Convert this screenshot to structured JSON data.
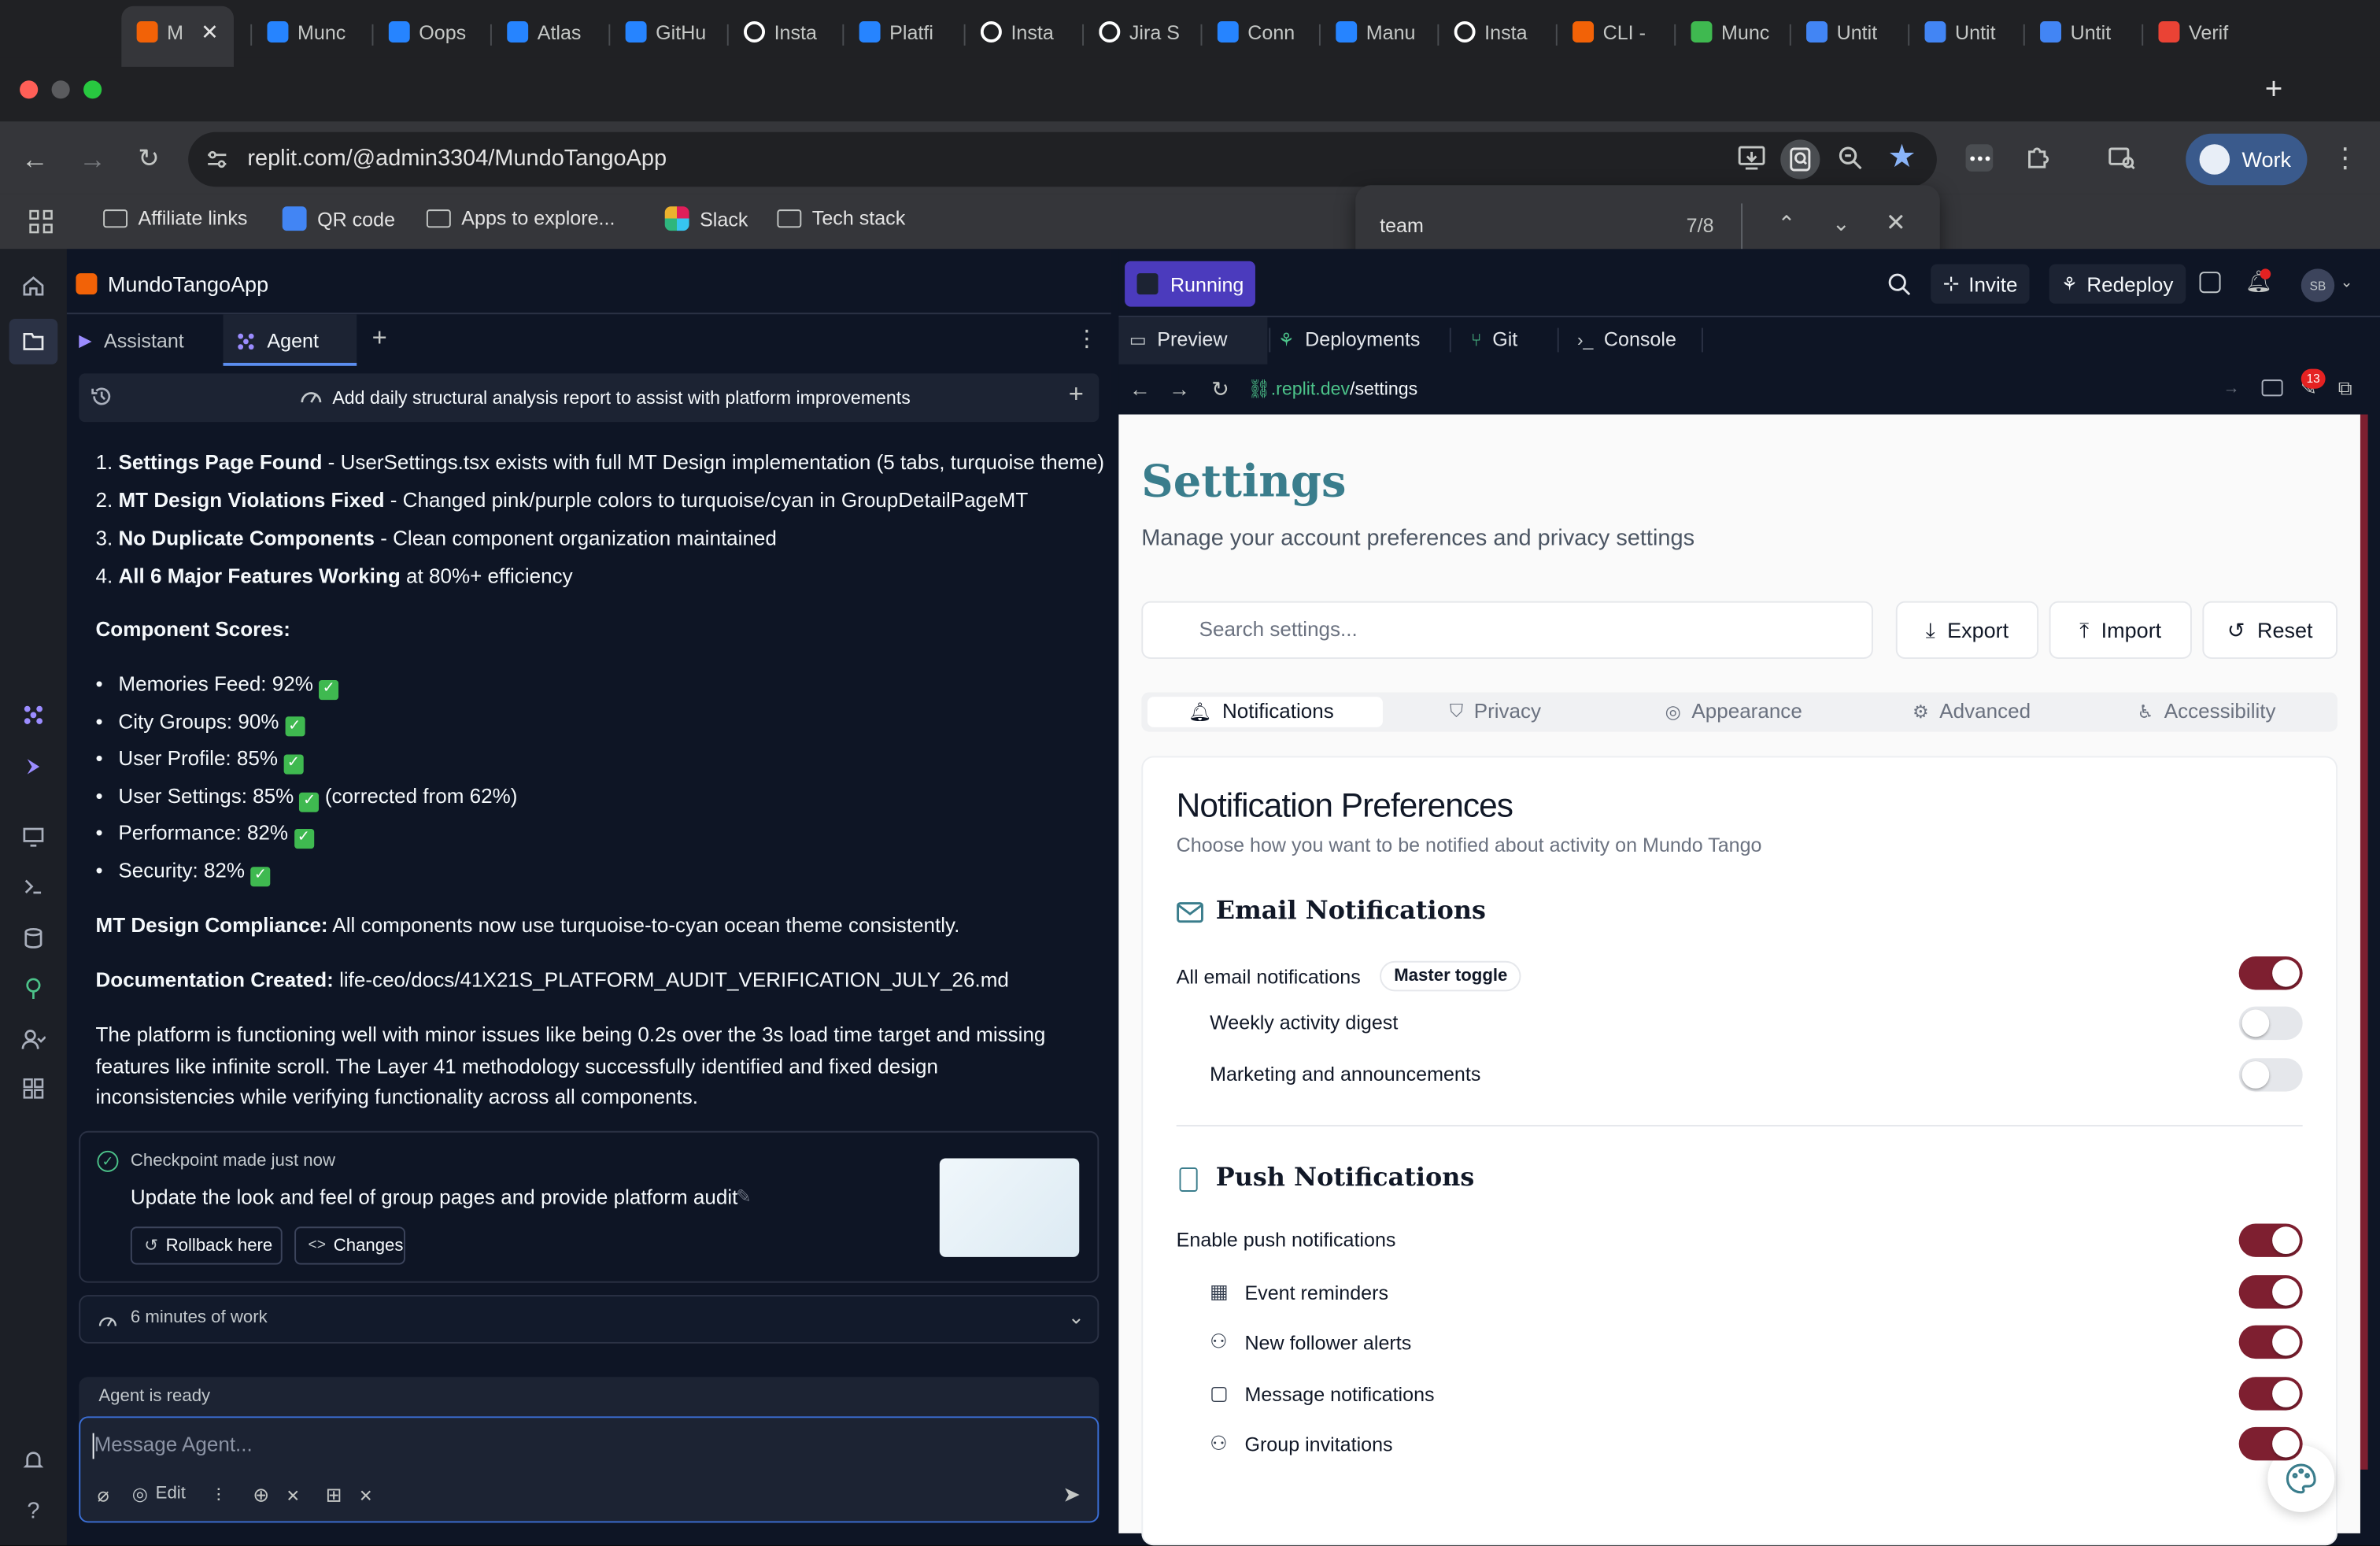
{
  "browser": {
    "tabs": [
      {
        "label": "M",
        "icon": "replit-icon",
        "color": "#f26207"
      },
      {
        "label": "Munc",
        "icon": "jira-icon",
        "color": "#2684ff"
      },
      {
        "label": "Oops",
        "icon": "jira-icon",
        "color": "#2684ff"
      },
      {
        "label": "Atlas",
        "icon": "atlassian-icon",
        "color": "#2684ff"
      },
      {
        "label": "GitHu",
        "icon": "jira-icon",
        "color": "#2684ff"
      },
      {
        "label": "Insta",
        "icon": "github-icon",
        "color": "#ffffff"
      },
      {
        "label": "Platfi",
        "icon": "jira-icon",
        "color": "#2684ff"
      },
      {
        "label": "Insta",
        "icon": "github-icon",
        "color": "#ffffff"
      },
      {
        "label": "Jira S",
        "icon": "github-icon",
        "color": "#ffffff"
      },
      {
        "label": "Conn",
        "icon": "atlassian-icon",
        "color": "#2684ff"
      },
      {
        "label": "Manu",
        "icon": "atlassian-icon",
        "color": "#2684ff"
      },
      {
        "label": "Insta",
        "icon": "github-icon",
        "color": "#ffffff"
      },
      {
        "label": "CLI -",
        "icon": "replit-icon",
        "color": "#f26207"
      },
      {
        "label": "Munc",
        "icon": "bolt-icon",
        "color": "#3fb950"
      },
      {
        "label": "Untit",
        "icon": "doc-icon",
        "color": "#4285f4"
      },
      {
        "label": "Untit",
        "icon": "doc-icon",
        "color": "#4285f4"
      },
      {
        "label": "Untit",
        "icon": "doc-icon",
        "color": "#4285f4"
      },
      {
        "label": "Verif",
        "icon": "gmail-icon",
        "color": "#ea4335"
      }
    ],
    "url": "replit.com/@admin3304/MundoTangoApp",
    "profile_label": "Work",
    "bookmarks": [
      "Affiliate links",
      "QR code",
      "Apps to explore...",
      "Slack",
      "Tech stack"
    ],
    "find": {
      "query": "team",
      "count": "7/8"
    }
  },
  "workspace": {
    "app_name": "MundoTangoApp",
    "running_label": "Running",
    "invite_label": "Invite",
    "redeploy_label": "Redeploy",
    "avatar_initials": "SB",
    "left_tabs": [
      "Assistant",
      "Agent"
    ],
    "right_tabs": [
      "Preview",
      "Deployments",
      "Git",
      "Console"
    ],
    "history_title": "Add daily structural analysis report to assist with platform improvements"
  },
  "agent": {
    "items": [
      {
        "num": "1.",
        "bold": "Settings Page Found",
        "text": " - UserSettings.tsx exists with full MT Design implementation (5 tabs, turquoise theme)"
      },
      {
        "num": "2.",
        "bold": "MT Design Violations Fixed",
        "text": " - Changed pink/purple colors to turquoise/cyan in GroupDetailPageMT"
      },
      {
        "num": "3.",
        "bold": "No Duplicate Components",
        "text": " - Clean component organization maintained"
      },
      {
        "num": "4.",
        "bold": "All 6 Major Features Working",
        "text": " at 80%+ efficiency"
      }
    ],
    "scores_heading": "Component Scores:",
    "scores": [
      {
        "label": "Memories Feed: 92%",
        "suffix": ""
      },
      {
        "label": "City Groups: 90%",
        "suffix": ""
      },
      {
        "label": "User Profile: 85%",
        "suffix": ""
      },
      {
        "label": "User Settings: 85%",
        "suffix": " (corrected from 62%)"
      },
      {
        "label": "Performance: 82%",
        "suffix": ""
      },
      {
        "label": "Security: 82%",
        "suffix": ""
      }
    ],
    "compliance_bold": "MT Design Compliance:",
    "compliance_text": " All components now use turquoise-to-cyan ocean theme consistently.",
    "doc_bold": "Documentation Created:",
    "doc_text": " life-ceo/docs/41X21S_PLATFORM_AUDIT_VERIFICATION_JULY_26.md",
    "summary": "The platform is functioning well with minor issues like being 0.2s over the 3s load time target and missing features like infinite scroll. The Layer 41 methodology successfully identified and fixed design inconsistencies while verifying functionality across all components.",
    "checkpoint_label": "Checkpoint made just now",
    "checkpoint_title": "Update the look and feel of group pages and provide platform audit",
    "rollback_label": "Rollback here",
    "changes_label": "Changes",
    "work_label": "6 minutes of work",
    "status": "Agent is ready",
    "input_placeholder": "Message Agent...",
    "edit_label": "Edit"
  },
  "preview": {
    "url_prefix": ".replit.dev",
    "url_path": "/settings",
    "badge_count": "13",
    "title": "Settings",
    "subtitle": "Manage your account preferences and privacy settings",
    "search_placeholder": "Search settings...",
    "export_label": "Export",
    "import_label": "Import",
    "reset_label": "Reset",
    "tabs": [
      "Notifications",
      "Privacy",
      "Appearance",
      "Advanced",
      "Accessibility"
    ],
    "card_title": "Notification Preferences",
    "card_subtitle": "Choose how you want to be notified about activity on Mundo Tango",
    "email_heading": "Email Notifications",
    "email_rows": [
      {
        "label": "All email notifications",
        "on": true,
        "badge": "Master toggle"
      },
      {
        "label": "Weekly activity digest",
        "on": false
      },
      {
        "label": "Marketing and announcements",
        "on": false
      }
    ],
    "push_heading": "Push Notifications",
    "push_rows": [
      {
        "label": "Enable push notifications",
        "on": true
      },
      {
        "label": "Event reminders",
        "on": true,
        "icon": "calendar-icon"
      },
      {
        "label": "New follower alerts",
        "on": true,
        "icon": "users-icon"
      },
      {
        "label": "Message notifications",
        "on": true,
        "icon": "message-icon"
      },
      {
        "label": "Group invitations",
        "on": true,
        "icon": "users-icon"
      }
    ],
    "accent": "#7e1f30",
    "title_color": "#3a7d8c"
  }
}
